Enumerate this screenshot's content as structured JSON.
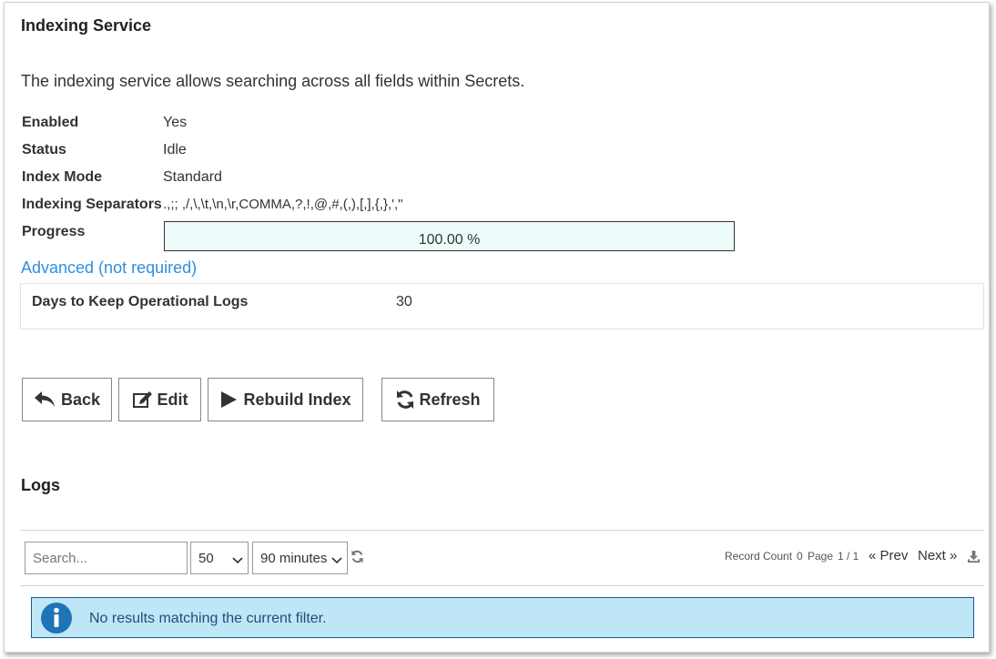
{
  "page": {
    "title": "Indexing Service",
    "description": "The indexing service allows searching across all fields within Secrets."
  },
  "details": {
    "enabled": {
      "label": "Enabled",
      "value": "Yes"
    },
    "status": {
      "label": "Status",
      "value": "Idle"
    },
    "index_mode": {
      "label": "Index Mode",
      "value": "Standard"
    },
    "separators": {
      "label": "Indexing Separators",
      "value": ".,;; ,/,\\,\\t,\\n,\\r,COMMA,?,!,@,#,(,),[,],{,},',\""
    },
    "progress": {
      "label": "Progress",
      "text": "100.00 %",
      "fraction": 1.0
    }
  },
  "advanced": {
    "link_label": "Advanced (not required)",
    "days_label": "Days to Keep Operational Logs",
    "days_value": "30"
  },
  "buttons": {
    "back": "Back",
    "edit": "Edit",
    "rebuild": "Rebuild Index",
    "refresh": "Refresh"
  },
  "logs": {
    "title": "Logs",
    "search_placeholder": "Search...",
    "page_size": "50",
    "time_range": "90 minutes",
    "record_count_label": "Record Count",
    "record_count": "0",
    "page_label": "Page",
    "page_value": "1 / 1",
    "prev": "Prev",
    "next": "Next",
    "empty_message": "No results matching the current filter."
  },
  "colors": {
    "link": "#2f8fdd",
    "progress_bg": "#eaf8f8",
    "alert_bg": "#bfe6f7",
    "alert_border": "#1a5f8e",
    "info_icon": "#1f73b7"
  },
  "icons": {
    "back": "reply-arrow-icon",
    "edit": "edit-square-icon",
    "rebuild": "play-icon",
    "refresh": "refresh-icon",
    "download": "download-icon",
    "info": "info-circle-icon"
  }
}
